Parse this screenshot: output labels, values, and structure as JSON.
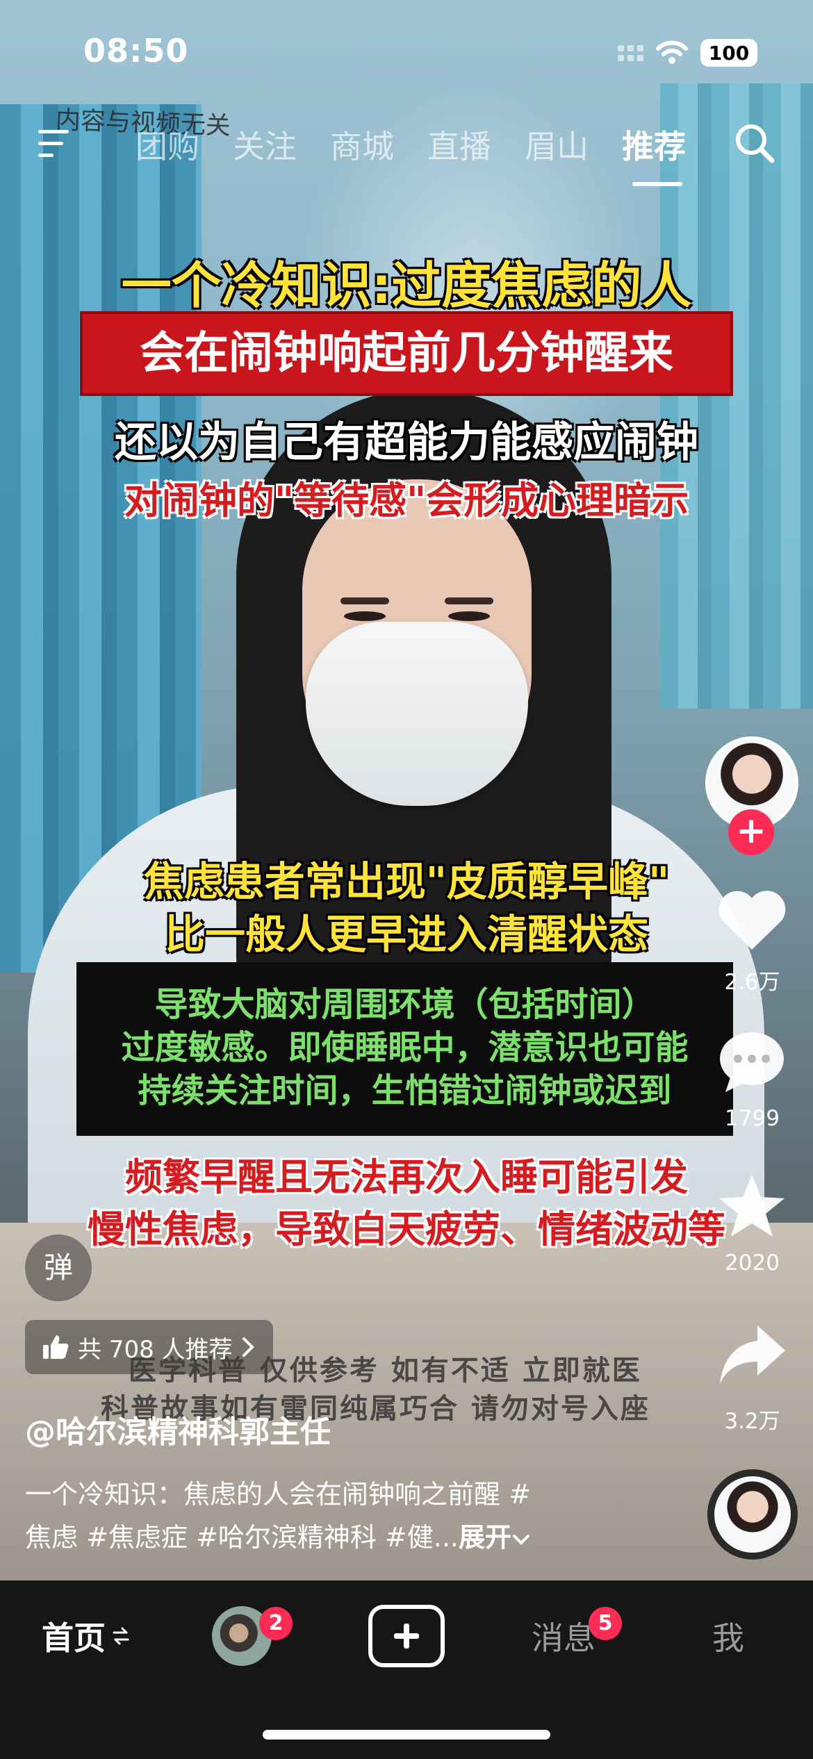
{
  "status_bar": {
    "time": "08:50",
    "battery": "100"
  },
  "top_nav": {
    "disclaimer": "内容与视频无关",
    "tabs": [
      "团购",
      "关注",
      "商城",
      "直播",
      "眉山",
      "推荐"
    ],
    "active_tab": "推荐"
  },
  "captions": {
    "line1": "一个冷知识:过度焦虑的人",
    "line2": "会在闹钟响起前几分钟醒来",
    "line3": "还以为自己有超能力能感应闹钟",
    "line4": "对闹钟的\"等待感\"会形成心理暗示",
    "line5": "焦虑患者常出现\"皮质醇早峰\"",
    "line6": "比一般人更早进入清醒状态",
    "box_line1": "导致大脑对周围环境（包括时间）",
    "box_line2": "过度敏感。即使睡眠中，潜意识也可能",
    "box_line3": "持续关注时间，生怕错过闹钟或迟到",
    "line7": "频繁早醒且无法再次入睡可能引发",
    "line8": "慢性焦虑，导致白天疲劳、情绪波动等",
    "watermark1": "医学科普 仅供参考 如有不适 立即就医",
    "watermark2": "科普故事如有雷同纯属巧合 请勿对号入座"
  },
  "rail": {
    "follow_label": "+",
    "likes": "2.6万",
    "comments": "1799",
    "favorites": "2020",
    "shares": "3.2万"
  },
  "info": {
    "danmu_label": "弹",
    "recommend_text": "共 708 人推荐",
    "author": "@哈尔滨精神科郭主任",
    "desc_line1": "一个冷知识：焦虑的人会在闹钟响之前醒 #",
    "desc_line2": "焦虑 #焦虑症 #哈尔滨精神科 #健...",
    "expand_label": "展开"
  },
  "tabbar": {
    "home": "首页",
    "friends_badge": "2",
    "messages": "消息",
    "messages_badge": "5",
    "me": "我"
  }
}
